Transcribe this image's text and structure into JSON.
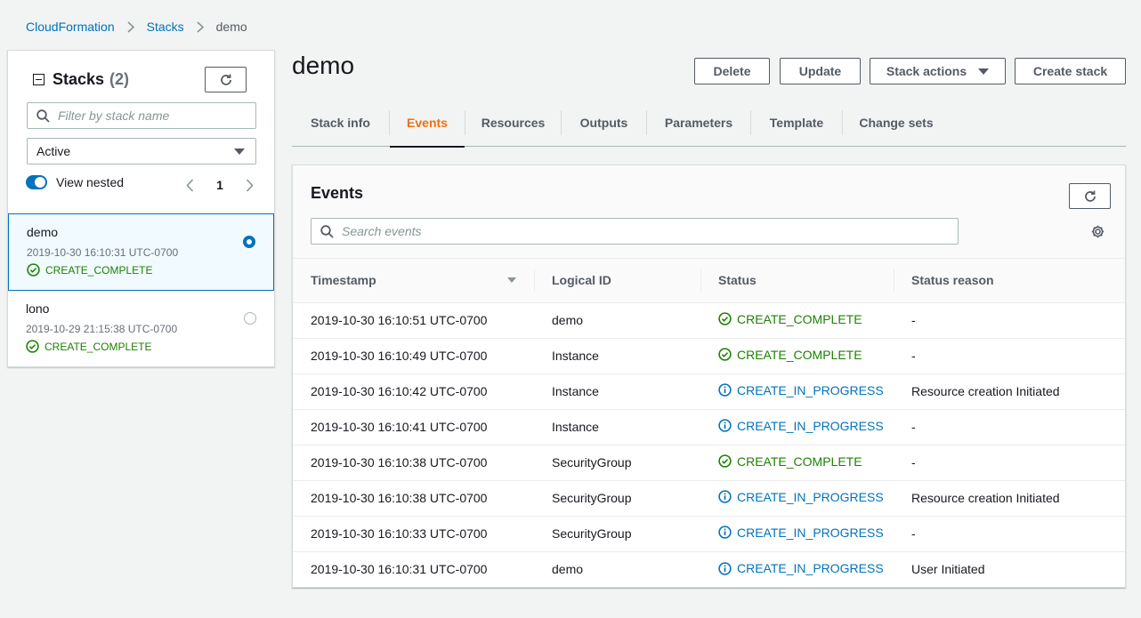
{
  "breadcrumb": {
    "root": "CloudFormation",
    "section": "Stacks",
    "current": "demo"
  },
  "sidebar": {
    "title": "Stacks",
    "count": "(2)",
    "filter_placeholder": "Filter by stack name",
    "status_filter": "Active",
    "view_nested_label": "View nested",
    "page": "1",
    "stacks": [
      {
        "name": "demo",
        "time": "2019-10-30 16:10:31 UTC-0700",
        "status": "CREATE_COMPLETE",
        "selected": true
      },
      {
        "name": "lono",
        "time": "2019-10-29 21:15:38 UTC-0700",
        "status": "CREATE_COMPLETE",
        "selected": false
      }
    ]
  },
  "main": {
    "title": "demo",
    "actions": {
      "delete": "Delete",
      "update": "Update",
      "stack_actions": "Stack actions",
      "create": "Create stack"
    },
    "tabs": [
      "Stack info",
      "Events",
      "Resources",
      "Outputs",
      "Parameters",
      "Template",
      "Change sets"
    ],
    "active_tab": "Events"
  },
  "events": {
    "title": "Events",
    "search_placeholder": "Search events",
    "columns": [
      "Timestamp",
      "Logical ID",
      "Status",
      "Status reason"
    ],
    "rows": [
      {
        "timestamp": "2019-10-30 16:10:51 UTC-0700",
        "logical_id": "demo",
        "status": "CREATE_COMPLETE",
        "reason": "-"
      },
      {
        "timestamp": "2019-10-30 16:10:49 UTC-0700",
        "logical_id": "Instance",
        "status": "CREATE_COMPLETE",
        "reason": "-"
      },
      {
        "timestamp": "2019-10-30 16:10:42 UTC-0700",
        "logical_id": "Instance",
        "status": "CREATE_IN_PROGRESS",
        "reason": "Resource creation Initiated"
      },
      {
        "timestamp": "2019-10-30 16:10:41 UTC-0700",
        "logical_id": "Instance",
        "status": "CREATE_IN_PROGRESS",
        "reason": "-"
      },
      {
        "timestamp": "2019-10-30 16:10:38 UTC-0700",
        "logical_id": "SecurityGroup",
        "status": "CREATE_COMPLETE",
        "reason": "-"
      },
      {
        "timestamp": "2019-10-30 16:10:38 UTC-0700",
        "logical_id": "SecurityGroup",
        "status": "CREATE_IN_PROGRESS",
        "reason": "Resource creation Initiated"
      },
      {
        "timestamp": "2019-10-30 16:10:33 UTC-0700",
        "logical_id": "SecurityGroup",
        "status": "CREATE_IN_PROGRESS",
        "reason": "-"
      },
      {
        "timestamp": "2019-10-30 16:10:31 UTC-0700",
        "logical_id": "demo",
        "status": "CREATE_IN_PROGRESS",
        "reason": "User Initiated"
      }
    ]
  },
  "colors": {
    "link": "#0073bb",
    "success": "#1d8102",
    "active_tab": "#ec7211"
  },
  "icons": {
    "complete": "check-circle-icon",
    "progress": "info-circle-icon",
    "refresh": "refresh-icon",
    "search": "search-icon",
    "settings": "gear-icon"
  }
}
